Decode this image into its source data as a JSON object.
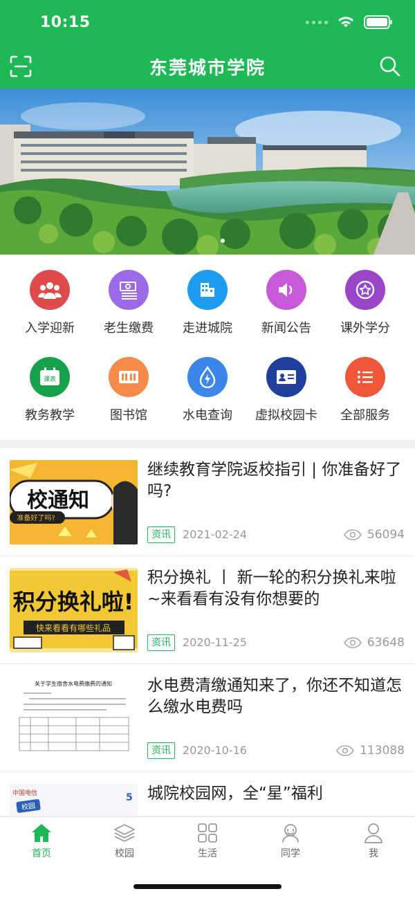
{
  "status_bar": {
    "time": "10:15"
  },
  "header": {
    "title": "东莞城市学院",
    "bg_color": "#1fb857"
  },
  "services": [
    {
      "label": "入学迎新",
      "icon": "people-icon",
      "color": "#e04a4a"
    },
    {
      "label": "老生缴费",
      "icon": "money-stack-icon",
      "color": "#9a6ae8"
    },
    {
      "label": "走进城院",
      "icon": "building-icon",
      "color": "#1d9cf0"
    },
    {
      "label": "新闻公告",
      "icon": "speaker-icon",
      "color": "#c85ad8"
    },
    {
      "label": "课外学分",
      "icon": "star-badge-icon",
      "color": "#9a46c8"
    },
    {
      "label": "教务教学",
      "icon": "calendar-icon",
      "color": "#17a14b",
      "icon_text": "课表"
    },
    {
      "label": "图书馆",
      "icon": "library-icon",
      "color": "#f58a4a"
    },
    {
      "label": "水电查询",
      "icon": "water-bolt-icon",
      "color": "#3c86e8"
    },
    {
      "label": "虚拟校园卡",
      "icon": "id-card-icon",
      "color": "#1f3f9c"
    },
    {
      "label": "全部服务",
      "icon": "list-icon",
      "color": "#f0563a"
    }
  ],
  "news": [
    {
      "title": "继续教育学院返校指引 | 你准备好了吗?",
      "tag": "资讯",
      "date": "2021-02-24",
      "views": "56094",
      "thumb_text": "校通知",
      "thumb_sub": "准备好了吗?"
    },
    {
      "title": "积分换礼 丨 新一轮的积分换礼来啦~来看看有没有你想要的",
      "tag": "资讯",
      "date": "2020-11-25",
      "views": "63648",
      "thumb_text": "积分换礼啦!",
      "thumb_sub": "快来看看有哪些礼品"
    },
    {
      "title": "水电费清缴通知来了，你还不知道怎么缴水电费吗",
      "tag": "资讯",
      "date": "2020-10-16",
      "views": "113088",
      "thumb_text": "关于学生宿舍水电费缴费的通知"
    },
    {
      "title": "城院校园网，全“星”福利",
      "thumb_text": "校园",
      "thumb_brand": "中国电信"
    }
  ],
  "tabbar": [
    {
      "label": "首页",
      "icon": "home-icon",
      "active": true
    },
    {
      "label": "校园",
      "icon": "layers-icon",
      "active": false
    },
    {
      "label": "生活",
      "icon": "grid-icon",
      "active": false
    },
    {
      "label": "同学",
      "icon": "friends-icon",
      "active": false
    },
    {
      "label": "我",
      "icon": "user-icon",
      "active": false
    }
  ]
}
